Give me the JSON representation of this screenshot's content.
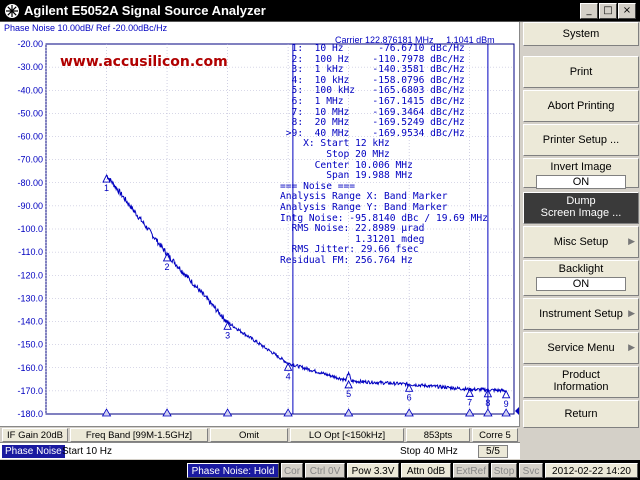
{
  "window": {
    "title": "Agilent E5052A Signal Source Analyzer",
    "buttons": [
      "_",
      "□",
      "×"
    ]
  },
  "trace": {
    "header": "Phase Noise 10.00dB/ Ref -20.00dBc/Hz",
    "url": "www.accusilicon.com",
    "carrier": "Carrier 122.876181 MHz",
    "carrier_power": "1.1041 dBm",
    "y_labels": [
      "-20.00",
      "-30.00",
      "-40.00",
      "-50.00",
      "-60.00",
      "-70.00",
      "-80.00",
      "-90.00",
      "-100.0",
      "-110.0",
      "-120.0",
      "-130.0",
      "-140.0",
      "-150.0",
      "-160.0",
      "-170.0",
      "-180.0"
    ],
    "marker_table": [
      "  1:  10 Hz      -76.6710 dBc/Hz",
      "  2:  100 Hz    -110.7978 dBc/Hz",
      "  3:  1 kHz     -140.3581 dBc/Hz",
      "  4:  10 kHz    -158.0796 dBc/Hz",
      "  5:  100 kHz   -165.6803 dBc/Hz",
      "  6:  1 MHz     -167.1415 dBc/Hz",
      "  7:  10 MHz    -169.3464 dBc/Hz",
      "  8:  20 MHz    -169.5249 dBc/Hz",
      " >9:  40 MHz    -169.9534 dBc/Hz",
      "    X: Start 12 kHz",
      "        Stop 20 MHz",
      "      Center 10.006 MHz",
      "        Span 19.988 MHz",
      "=== Noise ===",
      "Analysis Range X: Band Marker",
      "Analysis Range Y: Band Marker",
      "Intg Noise: -95.8140 dBc / 19.69 MHz",
      "  RMS Noise: 22.8989 µrad",
      "             1.31201 mdeg",
      "  RMS Jitter: 29.66 fsec",
      "Residual FM: 256.764 Hz"
    ],
    "markers": [
      {
        "label": "1",
        "freq_hz": 10,
        "value": -76.671
      },
      {
        "label": "2",
        "freq_hz": 100,
        "value": -110.7978
      },
      {
        "label": "3",
        "freq_hz": 1000,
        "value": -140.3581
      },
      {
        "label": "4",
        "freq_hz": 10000,
        "value": -158.0796
      },
      {
        "label": "5",
        "freq_hz": 100000,
        "value": -165.6803
      },
      {
        "label": "6",
        "freq_hz": 1000000,
        "value": -167.1415
      },
      {
        "label": "7",
        "freq_hz": 10000000,
        "value": -169.3464
      },
      {
        "label": "8",
        "freq_hz": 20000000,
        "value": -169.5249
      },
      {
        "label": "9",
        "freq_hz": 40000000,
        "value": -169.9534
      }
    ],
    "band_markers_hz": [
      12000,
      20000000
    ],
    "trace_color": "#0000c0"
  },
  "softkeys": [
    {
      "label": "System",
      "type": "title"
    },
    {
      "label": "Print",
      "type": "button"
    },
    {
      "label": "Abort Printing",
      "type": "button"
    },
    {
      "label": "Printer Setup ...",
      "type": "button"
    },
    {
      "label": "Invert Image",
      "value": "ON",
      "type": "toggle"
    },
    {
      "label": "Dump",
      "label2": "Screen Image ...",
      "type": "dark"
    },
    {
      "label": "Misc Setup",
      "type": "submenu"
    },
    {
      "label": "Backlight",
      "value": "ON",
      "type": "toggle"
    },
    {
      "label": "Instrument Setup",
      "type": "submenu"
    },
    {
      "label": "Service Menu",
      "type": "submenu"
    },
    {
      "label": "Product",
      "label2": "Information",
      "type": "button"
    },
    {
      "label": "Return",
      "type": "button"
    }
  ],
  "measbar": {
    "if_gain": "IF Gain 20dB",
    "freq_band": "Freq Band [99M-1.5GHz]",
    "omit": "Omit",
    "lo_opt": "LO Opt [<150kHz]",
    "points": "853pts",
    "corr": "Corre 5"
  },
  "sweepbar": {
    "mode": "Phase Noise",
    "start": "Start 10 Hz",
    "stop": "Stop 40 MHz",
    "page": "5/5"
  },
  "statusbar": {
    "meas": "Phase Noise: Hold",
    "cor": "Cor",
    "ctrl": "Ctrl 0V",
    "pow": "Pow 3.3V",
    "attn": "Attn 0dB",
    "extref": "ExtRef",
    "stop": "Stop",
    "svc": "Svc",
    "datetime": "2012-02-22 14:20"
  }
}
